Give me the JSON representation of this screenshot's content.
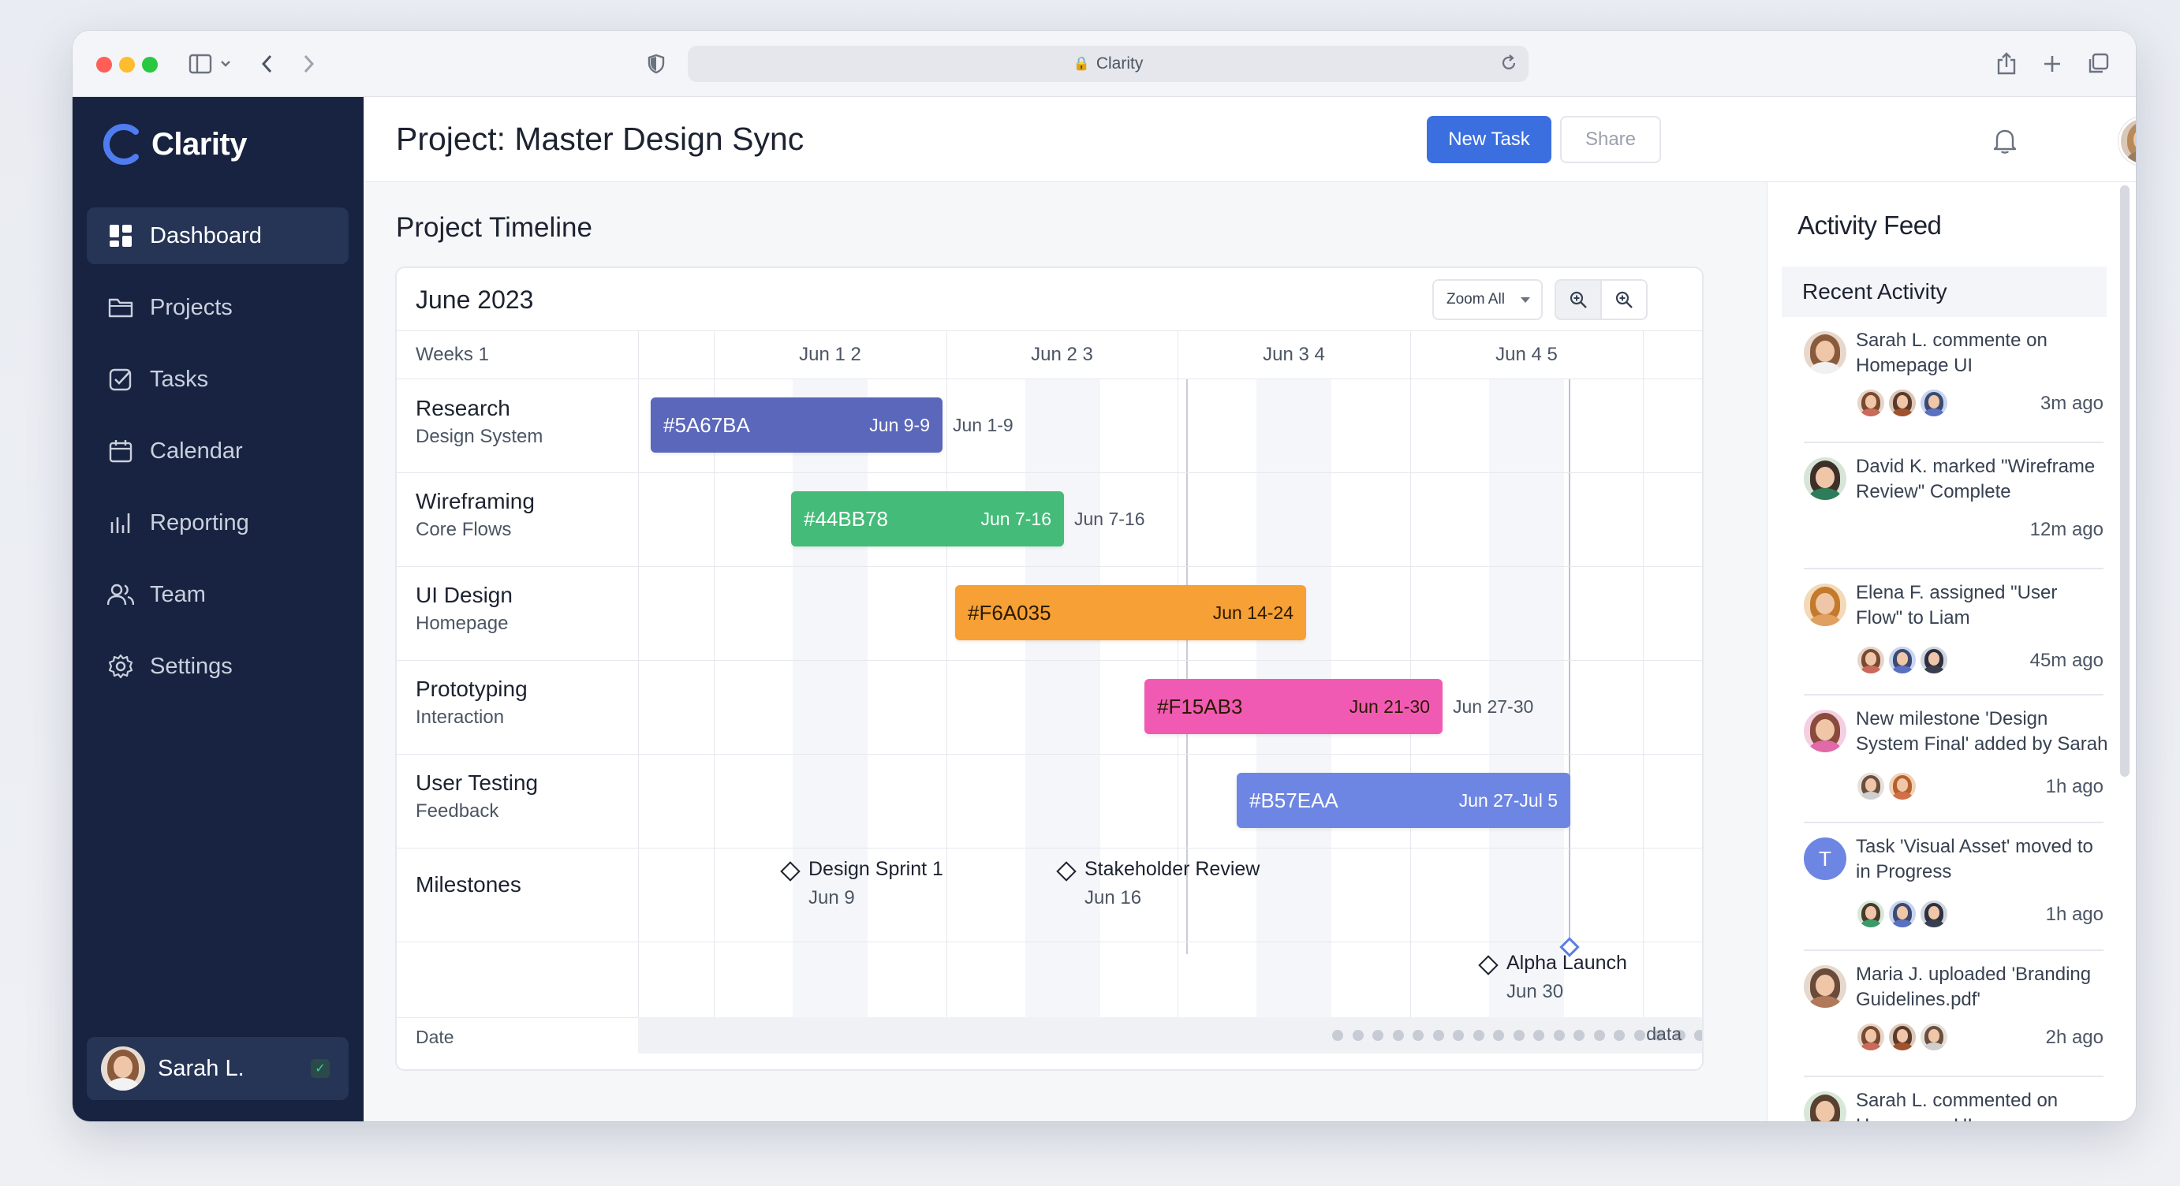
{
  "browser": {
    "url": "Clarity"
  },
  "sidebar": {
    "brand": "Clarity",
    "items": [
      {
        "label": "Dashboard",
        "icon": "dashboard-icon",
        "active": true
      },
      {
        "label": "Projects",
        "icon": "folder-icon",
        "active": false
      },
      {
        "label": "Tasks",
        "icon": "checkbox-icon",
        "active": false
      },
      {
        "label": "Calendar",
        "icon": "calendar-icon",
        "active": false
      },
      {
        "label": "Reporting",
        "icon": "bar-chart-icon",
        "active": false
      },
      {
        "label": "Team",
        "icon": "users-icon",
        "active": false
      },
      {
        "label": "Settings",
        "icon": "gear-icon",
        "active": false
      }
    ],
    "user": "Sarah L."
  },
  "header": {
    "title": "Project: Master Design Sync",
    "primary_button": "New Task",
    "secondary_button": "Share"
  },
  "timeline": {
    "section_title": "Project Timeline",
    "month": "June 2023",
    "zoom_label": "Zoom All",
    "weeks_label": "Weeks 1",
    "weeks": [
      "Jun 1 2",
      "Jun 2 3",
      "Jun 3 4",
      "Jun 4 5"
    ],
    "rows": [
      {
        "name": "Research",
        "sub": "Design System",
        "bar_label": "#5A67BA",
        "bar_date": "Jun 9-9",
        "ext_date": "Jun 1-9",
        "color": "#5A67BA"
      },
      {
        "name": "Wireframing",
        "sub": "Core Flows",
        "bar_label": "#44BB78",
        "bar_date": "Jun 7-16",
        "ext_date": "Jun 7-16",
        "color": "#44BB78"
      },
      {
        "name": "UI Design",
        "sub": "Homepage",
        "bar_label": "#F6A035",
        "bar_date": "Jun 14-24",
        "ext_date": "",
        "color": "#F6A035"
      },
      {
        "name": "Prototyping",
        "sub": "Interaction",
        "bar_label": "#F15AB3",
        "bar_date": "Jun 21-30",
        "ext_date": "Jun 27-30",
        "color": "#F15AB3"
      },
      {
        "name": "User Testing",
        "sub": "Feedback",
        "bar_label": "#B57EAA",
        "bar_date": "Jun 27-Jul 5",
        "ext_date": "",
        "color": "#6E86E3"
      }
    ],
    "milestones_label": "Milestones",
    "milestones": [
      {
        "name": "Design Sprint 1",
        "date": "Jun 9"
      },
      {
        "name": "Stakeholder Review",
        "date": "Jun 16"
      },
      {
        "name": "Alpha Launch",
        "date": "Jun 30"
      }
    ],
    "footer_label": "Date",
    "footer_right": "data"
  },
  "activity": {
    "title": "Activity Feed",
    "subtitle": "Recent Activity",
    "items": [
      {
        "text": "Sarah L. commente on Homepage UI",
        "time": "3m ago"
      },
      {
        "text": "David K. marked \"Wireframe Review\" Complete",
        "time": "12m ago"
      },
      {
        "text": "Elena F. assigned \"User Flow\" to Liam",
        "time": "45m ago"
      },
      {
        "text": "New milestone 'Design System Final' added by Sarah",
        "time": "1h ago"
      },
      {
        "text": "Task 'Visual Asset' moved to in Progress",
        "time": "1h ago"
      },
      {
        "text": "Maria J. uploaded 'Branding Guidelines.pdf'",
        "time": "2h ago"
      },
      {
        "text": "Sarah L. commented on Hemepage UI",
        "time": ""
      }
    ]
  }
}
